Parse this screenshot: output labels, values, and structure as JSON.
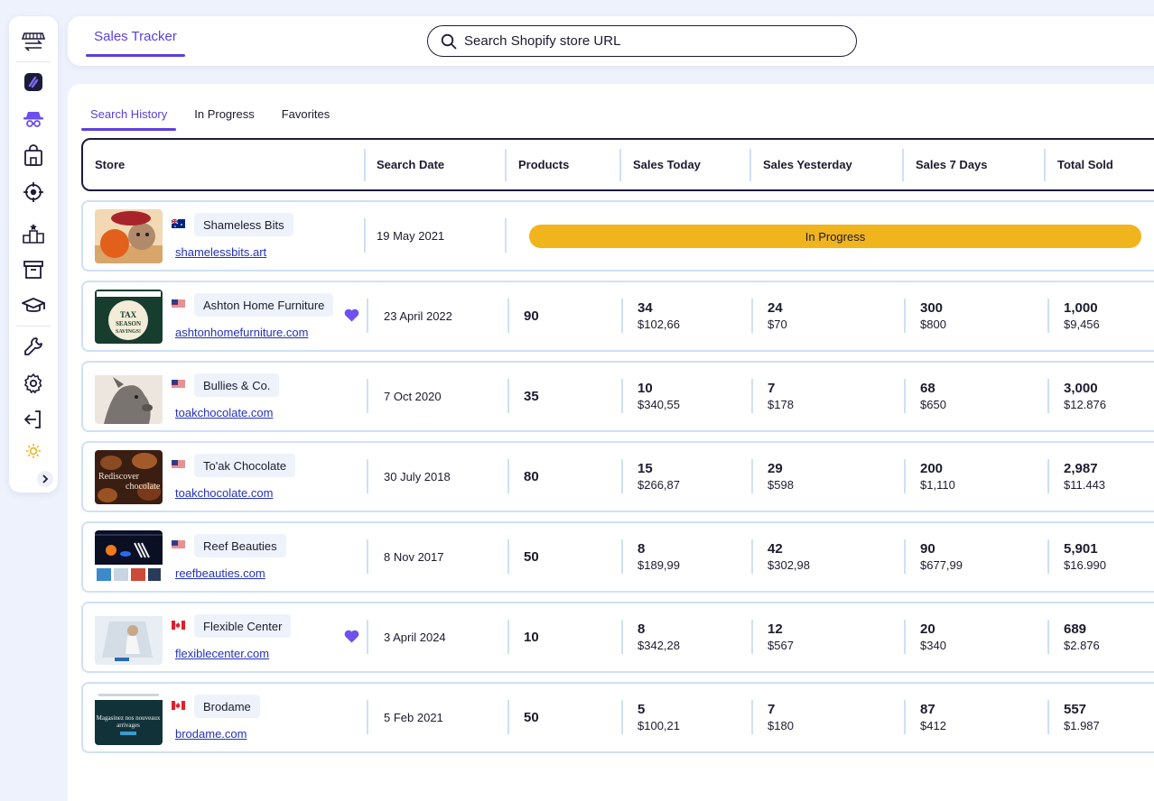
{
  "header": {
    "tab_label": "Sales Tracker",
    "search_placeholder": "Search Shopify store URL"
  },
  "tabs": [
    {
      "label": "Search History",
      "active": true
    },
    {
      "label": "In Progress",
      "active": false
    },
    {
      "label": "Favorites",
      "active": false
    }
  ],
  "columns": [
    "Store",
    "Search Date",
    "Products",
    "Sales Today",
    "Sales Yesterday",
    "Sales 7 Days",
    "Total Sold"
  ],
  "status_in_progress": "In Progress",
  "accent_color": "#5b3fe0",
  "progress_color": "#f0b41d",
  "rows": [
    {
      "name": "Shameless Bits",
      "url": "shamelessbits.art",
      "flag": "au",
      "date": "19 May 2021",
      "in_progress": true,
      "favorite": false
    },
    {
      "name": "Ashton Home Furniture",
      "url": "ashtonhomefurniture.com",
      "flag": "us",
      "date": "23 April 2022",
      "products": "90",
      "favorite": true,
      "today": [
        "34",
        "$102,66"
      ],
      "yesterday": [
        "24",
        "$70"
      ],
      "week": [
        "300",
        "$800"
      ],
      "total": [
        "1,000",
        "$9,456"
      ],
      "thumb_text": "TAX SEASON SAVINGS!"
    },
    {
      "name": "Bullies & Co.",
      "url": "toakchocolate.com",
      "flag": "us",
      "date": "7 Oct 2020",
      "products": "35",
      "favorite": false,
      "today": [
        "10",
        "$340,55"
      ],
      "yesterday": [
        "7",
        "$178"
      ],
      "week": [
        "68",
        "$650"
      ],
      "total": [
        "3,000",
        "$12.876"
      ]
    },
    {
      "name": "To'ak Chocolate",
      "url": "toakchocolate.com",
      "flag": "us",
      "date": "30 July 2018",
      "products": "80",
      "favorite": false,
      "today": [
        "15",
        "$266,87"
      ],
      "yesterday": [
        "29",
        "$598"
      ],
      "week": [
        "200",
        "$1,110"
      ],
      "total": [
        "2,987",
        "$11.443"
      ],
      "thumb_text": "Rediscover chocolate"
    },
    {
      "name": "Reef Beauties",
      "url": "reefbeauties.com",
      "flag": "us",
      "date": "8 Nov 2017",
      "products": "50",
      "favorite": false,
      "today": [
        "8",
        "$189,99"
      ],
      "yesterday": [
        "42",
        "$302,98"
      ],
      "week": [
        "90",
        "$677,99"
      ],
      "total": [
        "5,901",
        "$16.990"
      ]
    },
    {
      "name": "Flexible Center",
      "url": "flexiblecenter.com",
      "flag": "ca",
      "date": "3 April 2024",
      "products": "10",
      "favorite": true,
      "today": [
        "8",
        "$342,28"
      ],
      "yesterday": [
        "12",
        "$567"
      ],
      "week": [
        "20",
        "$340"
      ],
      "total": [
        "689",
        "$2.876"
      ]
    },
    {
      "name": "Brodame",
      "url": "brodame.com",
      "flag": "ca",
      "date": "5 Feb 2021",
      "products": "50",
      "favorite": false,
      "today": [
        "5",
        "$100,21"
      ],
      "yesterday": [
        "7",
        "$180"
      ],
      "week": [
        "87",
        "$412"
      ],
      "total": [
        "557",
        "$1.987"
      ],
      "thumb_text": "Magasinez nos nouveaux arrivages"
    }
  ],
  "sidebar_icons": [
    "store-switch-icon",
    "app-logo-icon",
    "spy-icon",
    "shopping-bag-icon",
    "target-icon",
    "podium-icon",
    "archive-icon",
    "graduation-cap-icon",
    "wrench-icon",
    "gear-icon",
    "logout-icon",
    "sun-icon"
  ]
}
